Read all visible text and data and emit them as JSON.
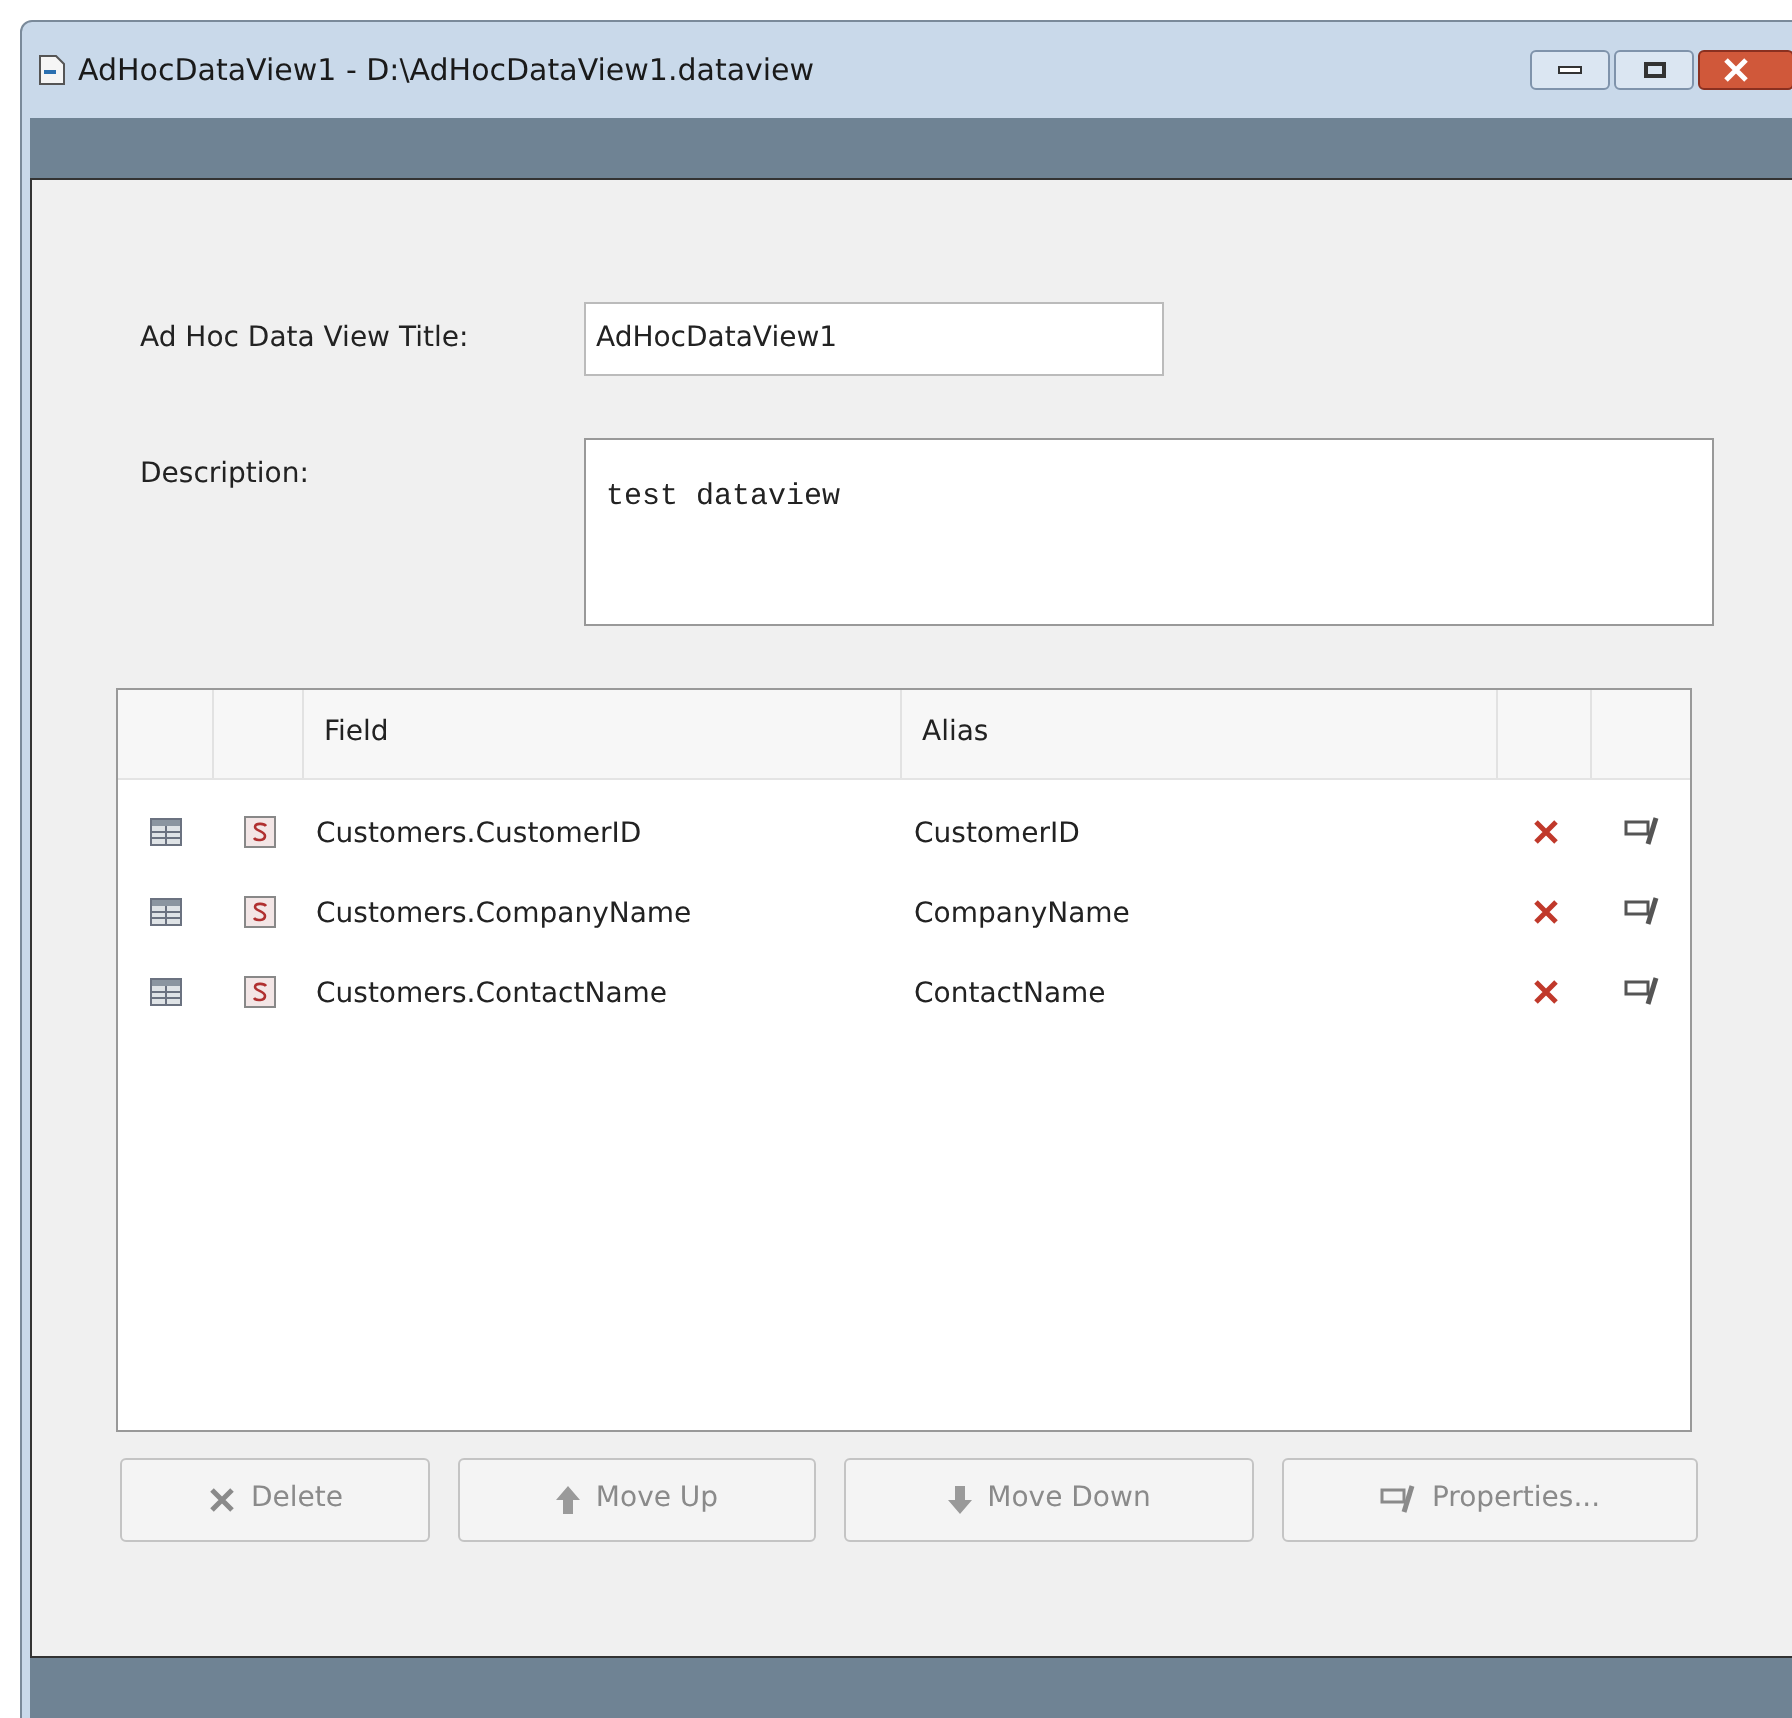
{
  "window": {
    "title": "AdHocDataView1 - D:\\AdHocDataView1.dataview"
  },
  "title_field": {
    "label": "Ad Hoc Data View Title:",
    "value": "AdHocDataView1"
  },
  "description_field": {
    "label": "Description:",
    "value": "test dataview"
  },
  "table": {
    "columns": [
      "Field",
      "Alias"
    ],
    "rows": [
      {
        "field": "Customers.CustomerID",
        "alias": "CustomerID"
      },
      {
        "field": "Customers.CompanyName",
        "alias": "CompanyName"
      },
      {
        "field": "Customers.ContactName",
        "alias": "ContactName"
      }
    ]
  },
  "buttons": [
    {
      "kind": "delete",
      "label": "Delete",
      "disabled": true
    },
    {
      "kind": "up",
      "label": "Move Up",
      "disabled": true
    },
    {
      "kind": "down",
      "label": "Move Down",
      "disabled": true
    },
    {
      "kind": "properties",
      "label": "Properties...",
      "disabled": true
    }
  ]
}
